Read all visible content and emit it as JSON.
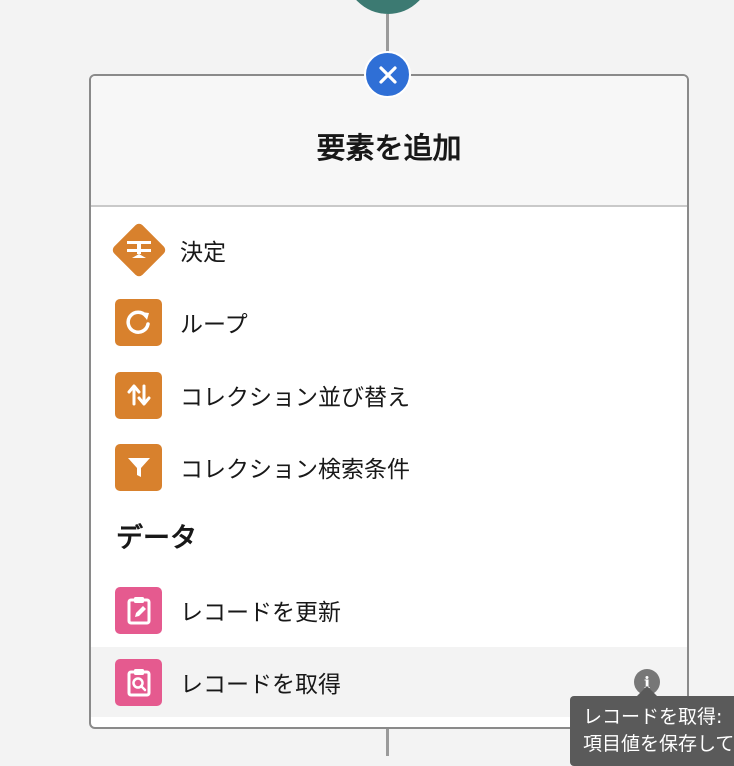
{
  "panel": {
    "title": "要素を追加"
  },
  "logic_items": [
    {
      "label": "決定",
      "icon": "decision-icon",
      "color": "#d8812d"
    },
    {
      "label": "ループ",
      "icon": "loop-icon",
      "color": "#d8812d"
    },
    {
      "label": "コレクション並び替え",
      "icon": "sort-icon",
      "color": "#d8812d"
    },
    {
      "label": "コレクション検索条件",
      "icon": "filter-icon",
      "color": "#d8812d"
    }
  ],
  "data_section": {
    "heading": "データ",
    "items": [
      {
        "label": "レコードを更新",
        "icon": "update-records-icon",
        "color": "#e55a8f"
      },
      {
        "label": "レコードを取得",
        "icon": "get-records-icon",
        "color": "#e55a8f"
      }
    ]
  },
  "tooltip": {
    "line1": "レコードを取得:",
    "line2": "項目値を保存して"
  }
}
